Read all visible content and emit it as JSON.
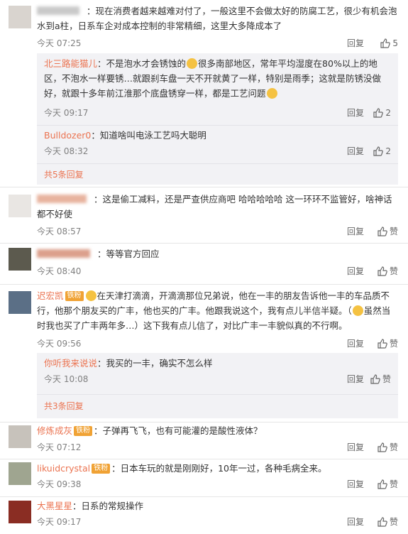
{
  "comments": [
    {
      "name": "",
      "badge": "",
      "text": "：现在消费者越来越难对付了，一般这里不会做太好的防腐工艺，很少有机会泡水到a柱，日系车企对成本控制的非常精细，这里大多降成本了",
      "time": "今天 07:25",
      "reply": "回复",
      "likes": "5",
      "replies": [
        {
          "name": "北三路能猫儿",
          "text": "：不是泡水才会锈蚀的",
          "text2": "很多南部地区，常年平均湿度在80%以上的地区，不泡水一样要锈…就跟刹车盘一天不开就黄了一样，特别是雨季；这就是防锈没做好，就跟十多年前江淮那个底盘锈穿一样，都是工艺问题",
          "time": "今天 09:17",
          "reply": "回复",
          "likes": "2"
        },
        {
          "name": "Bulldozer0",
          "text": "：知道啥叫电泳工艺吗大聪明",
          "time": "今天 08:32",
          "reply": "回复",
          "likes": "2"
        }
      ],
      "more": "共5条回复"
    },
    {
      "name": "",
      "badge": "",
      "text": "：这是偷工减料，还是严查供应商吧 哈哈哈哈哈 这一环环不监管好，啥神话都不好使",
      "time": "今天 08:57",
      "reply": "回复",
      "likes": "赞"
    },
    {
      "name": "",
      "badge": "",
      "text": "：等等官方回应",
      "time": "今天 08:40",
      "reply": "回复",
      "likes": "赞"
    },
    {
      "name": "迟宏凯",
      "badge": "铁粉",
      "text": "在天津打滴滴，开滴滴那位兄弟说，他在一丰的朋友告诉他一丰的车品质不行，他那个朋友买的广丰，他也买的广丰。他跟我说这个，我有点儿半信半疑。（",
      "text2": "虽然当时我也买了广丰两年多…）这下我有点儿信了，对比广丰一丰貌似真的不行啊。",
      "time": "今天 09:56",
      "reply": "回复",
      "likes": "赞",
      "replies": [
        {
          "name": "你听我来说说",
          "text": "：我买的一丰，确实不怎么样",
          "time": "今天 10:08",
          "reply": "回复",
          "likes": "赞"
        }
      ],
      "more": "共3条回复"
    },
    {
      "name": "修炼成灰",
      "badge": "铁粉",
      "text": "：子弹再飞飞，也有可能灌的是酸性液体？",
      "time": "今天 07:12",
      "reply": "回复",
      "likes": "赞"
    },
    {
      "name": "likuidcrystal",
      "badge": "铁粉",
      "text": "：日本车玩的就是刚刚好，10年一过，各种毛病全来。",
      "time": "今天 09:38",
      "reply": "回复",
      "likes": "赞"
    },
    {
      "name": "大黑星星",
      "badge": "",
      "text": "：日系的常规操作",
      "time": "今天 09:17",
      "reply": "回复",
      "likes": "赞"
    }
  ],
  "colors": {
    "name": "#eb7350",
    "badge_fan": "#f0a234",
    "badge_vip": "#7fb0e8",
    "meta": "#808080"
  }
}
